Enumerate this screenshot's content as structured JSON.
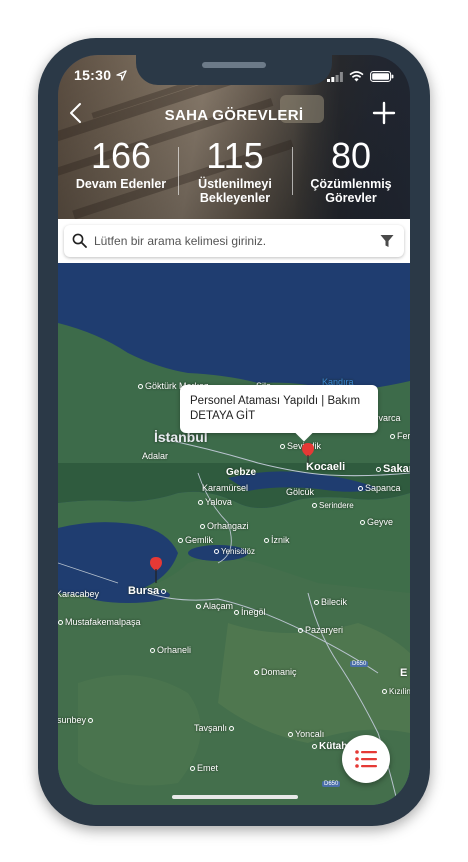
{
  "status": {
    "time": "15:30"
  },
  "header": {
    "title": "SAHA GÖREVLERİ",
    "stats": [
      {
        "value": "166",
        "label_line1": "Devam Edenler",
        "label_line2": ""
      },
      {
        "value": "115",
        "label_line1": "Üstlenilmeyi",
        "label_line2": "Bekleyenler"
      },
      {
        "value": "80",
        "label_line1": "Çözümlenmiş",
        "label_line2": "Görevler"
      }
    ]
  },
  "search": {
    "placeholder": "Lütfen bir arama kelimesi giriniz."
  },
  "map": {
    "labels": {
      "gokturk": "Göktürk Merkez",
      "sile": "Şile",
      "kandira": "Kandıra",
      "istanbul": "İstanbul",
      "adalar": "Adalar",
      "sevindik": "Sevindik",
      "kocaeli": "Kocaeli",
      "sakarya": "Sakar",
      "karasu": "ıvarca",
      "fer": "Fer",
      "gebze": "Gebze",
      "karamursel": "Karamürsel",
      "golcuk": "Gölcük",
      "sapanca": "Sapanca",
      "yalova": "Yalova",
      "serindere": "Serindere",
      "orhangazi": "Orhangazi",
      "geyve": "Geyve",
      "gemlik": "Gemlik",
      "iznik": "İznik",
      "yenisolz": "Yenisölöz",
      "karacabey": "Karacabey",
      "bursa": "Bursa",
      "bilecik": "Bilecik",
      "alacam": "Alaçam",
      "inegol": "İnegöl",
      "mustafakemalpasa": "Mustafakemalpaşa",
      "pazaryeri": "Pazaryeri",
      "orhaneli": "Orhaneli",
      "domanic": "Domaniç",
      "kiziline": "Kızılinе",
      "e": "E",
      "susurluk": "rsunbey",
      "tavsanli": "Tavşanlı",
      "yoncali": "Yoncalı",
      "kutahya": "Kütah",
      "emet": "Emet",
      "road_e": "D650",
      "road_d": "D650"
    },
    "callout": {
      "line1": "Personel Ataması Yapıldı | Bakım",
      "line2": "DETAYA GİT"
    }
  },
  "colors": {
    "accent": "#e53935",
    "phone_frame": "#2b3947",
    "water": "#1e3a6b"
  },
  "icons": {
    "back": "chevron-left-icon",
    "add": "plus-icon",
    "search": "search-icon",
    "filter": "filter-icon",
    "list": "list-icon",
    "pin": "map-pin-icon"
  }
}
